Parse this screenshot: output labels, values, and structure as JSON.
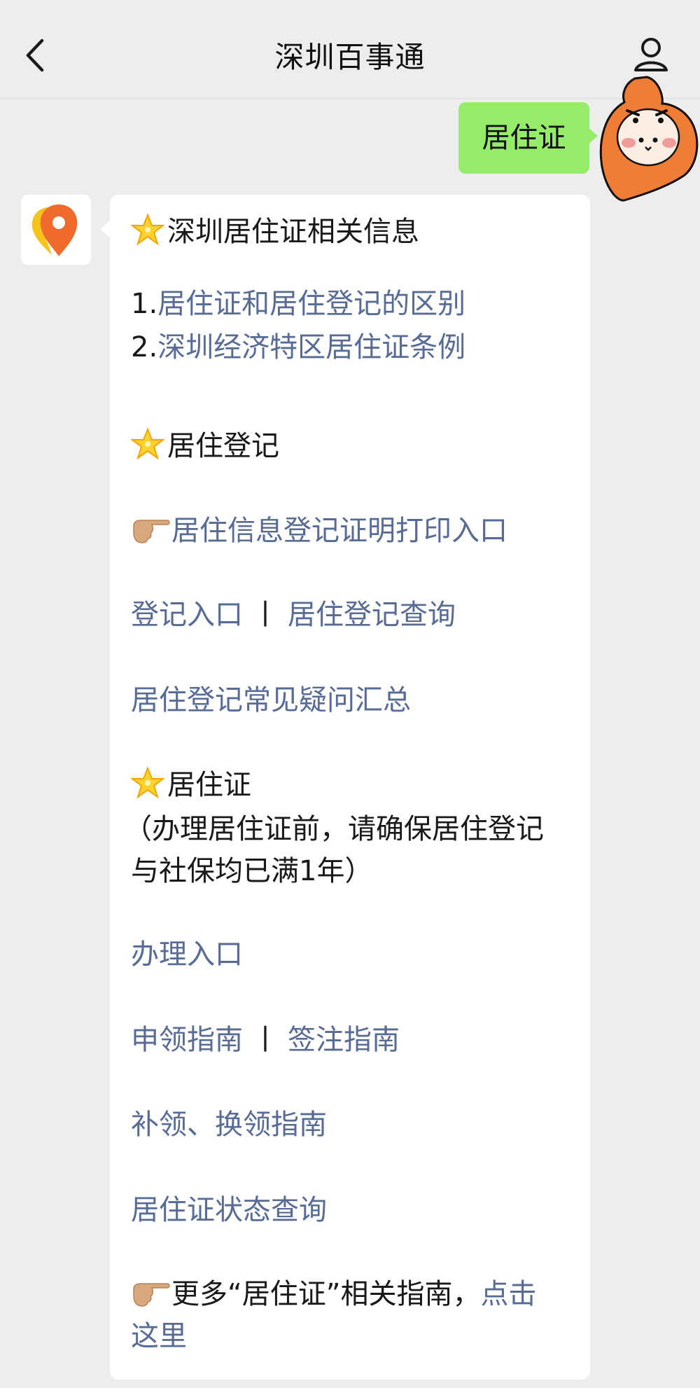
{
  "header": {
    "title": "深圳百事通"
  },
  "user_message": {
    "text": "居住证"
  },
  "bot_message": {
    "heading1": "深圳居住证相关信息",
    "item1_num": "1.",
    "item1_link": "居住证和居住登记的区别",
    "item2_num": "2.",
    "item2_link": "深圳经济特区居住证条例",
    "heading2": "居住登记",
    "print_link": "居住信息登记证明打印入口",
    "register_link": "登记入口",
    "separator": "丨",
    "query_link": "居住登记查询",
    "faq_link": "居住登记常见疑问汇总",
    "heading3": "居住证",
    "note_line1": "（办理居住证前，请确保居住登记",
    "note_line2": "与社保均已满1年）",
    "apply_link": "办理入口",
    "guide_link": "申领指南",
    "endorse_link": "签注指南",
    "reissue_link": "补领、换领指南",
    "status_link": "居住证状态查询",
    "more_text": "更多“居住证”相关指南，",
    "more_link_part1": "点击",
    "more_link_part2": "这里"
  },
  "colors": {
    "link": "#576b95",
    "user_bubble": "#95ec69",
    "background": "#ededed",
    "avatar_orange": "#f07d35"
  },
  "icons": [
    "back-arrow-icon",
    "profile-icon",
    "star-emoji-icon",
    "pointing-hand-emoji-icon",
    "location-pin-icon"
  ]
}
